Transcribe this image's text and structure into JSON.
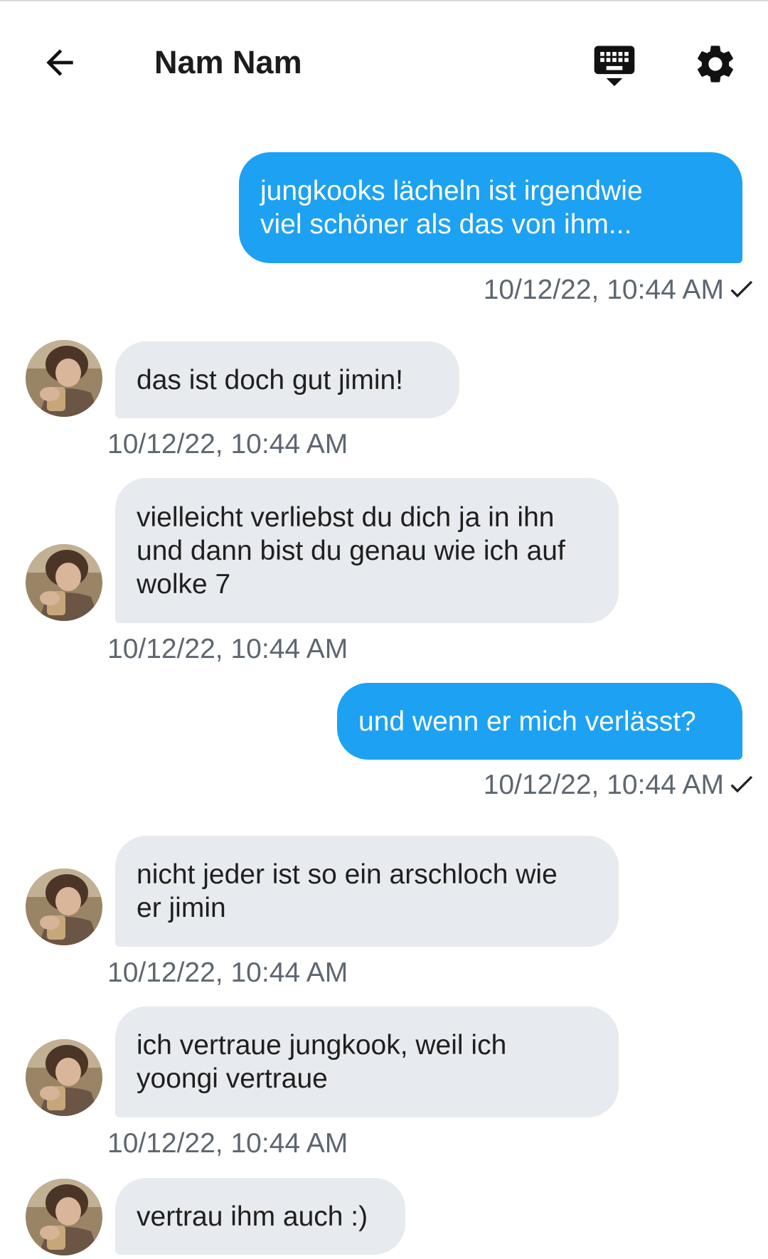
{
  "header": {
    "title": "Nam Nam",
    "icons": {
      "back": "arrow-left-icon",
      "keyboard": "keyboard-hide-icon",
      "settings": "gear-icon"
    }
  },
  "colors": {
    "outgoing_bubble": "#1da1f2",
    "incoming_bubble": "#e7eaee",
    "timestamp": "#5e6670"
  },
  "messages": [
    {
      "direction": "out",
      "text": "jungkooks lächeln ist irgendwie\nviel schöner als das von ihm...",
      "timestamp": "10/12/22, 10:44 AM",
      "read": true
    },
    {
      "direction": "in",
      "text": "das ist doch gut jimin!",
      "timestamp": "10/12/22, 10:44 AM"
    },
    {
      "direction": "in",
      "text": "vielleicht verliebst du dich ja in ihn\nund dann bist du genau wie ich auf\nwolke 7",
      "timestamp": "10/12/22, 10:44 AM"
    },
    {
      "direction": "out",
      "text": "und wenn er mich verlässt?",
      "timestamp": "10/12/22, 10:44 AM",
      "read": true
    },
    {
      "direction": "in",
      "text": "nicht jeder ist so ein arschloch wie\ner jimin",
      "timestamp": "10/12/22, 10:44 AM"
    },
    {
      "direction": "in",
      "text": "ich vertraue jungkook, weil ich\nyoongi vertraue",
      "timestamp": "10/12/22, 10:44 AM"
    },
    {
      "direction": "in",
      "text": "vertrau ihm auch :)",
      "timestamp": ""
    }
  ]
}
